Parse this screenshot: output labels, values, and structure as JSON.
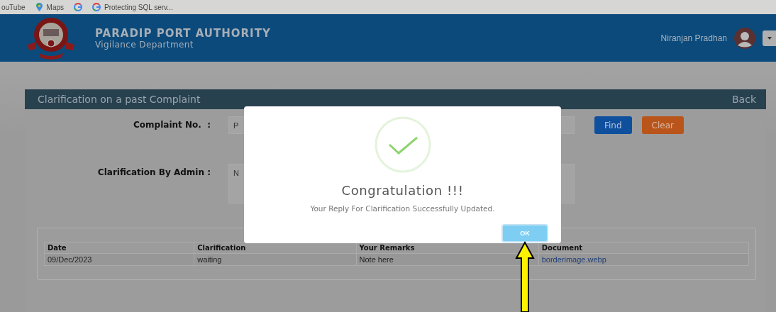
{
  "bookmarks": [
    {
      "kind": "youtube",
      "label": "ouTube"
    },
    {
      "kind": "maps",
      "label": "Maps"
    },
    {
      "kind": "google"
    },
    {
      "kind": "google",
      "label": "Protecting SQL serv..."
    }
  ],
  "header": {
    "title": "PARADIP PORT AUTHORITY",
    "subtitle": "Vigilance Department",
    "user": "Niranjan Pradhan"
  },
  "panel": {
    "title": "Clarification on a past Complaint",
    "back": "Back",
    "fields": [
      {
        "kind": "input",
        "label": "Complaint No.  :",
        "value": "P"
      },
      {
        "kind": "textarea",
        "label": "Clarification By Admin :",
        "value": "N"
      }
    ],
    "buttons": [
      {
        "kind": "primary",
        "label": "Find"
      },
      {
        "kind": "danger",
        "label": "Clear"
      }
    ],
    "table": {
      "columns": [
        "Date",
        "Clarification",
        "Your Remarks",
        "Document"
      ],
      "rows": [
        [
          "09/Dec/2023",
          "waiting",
          "Note here",
          "borderimage.webp"
        ]
      ]
    }
  },
  "dialog": {
    "title": "Congratulation !!!",
    "message": "Your Reply For Clarification Successfully Updated.",
    "button": "OK"
  }
}
